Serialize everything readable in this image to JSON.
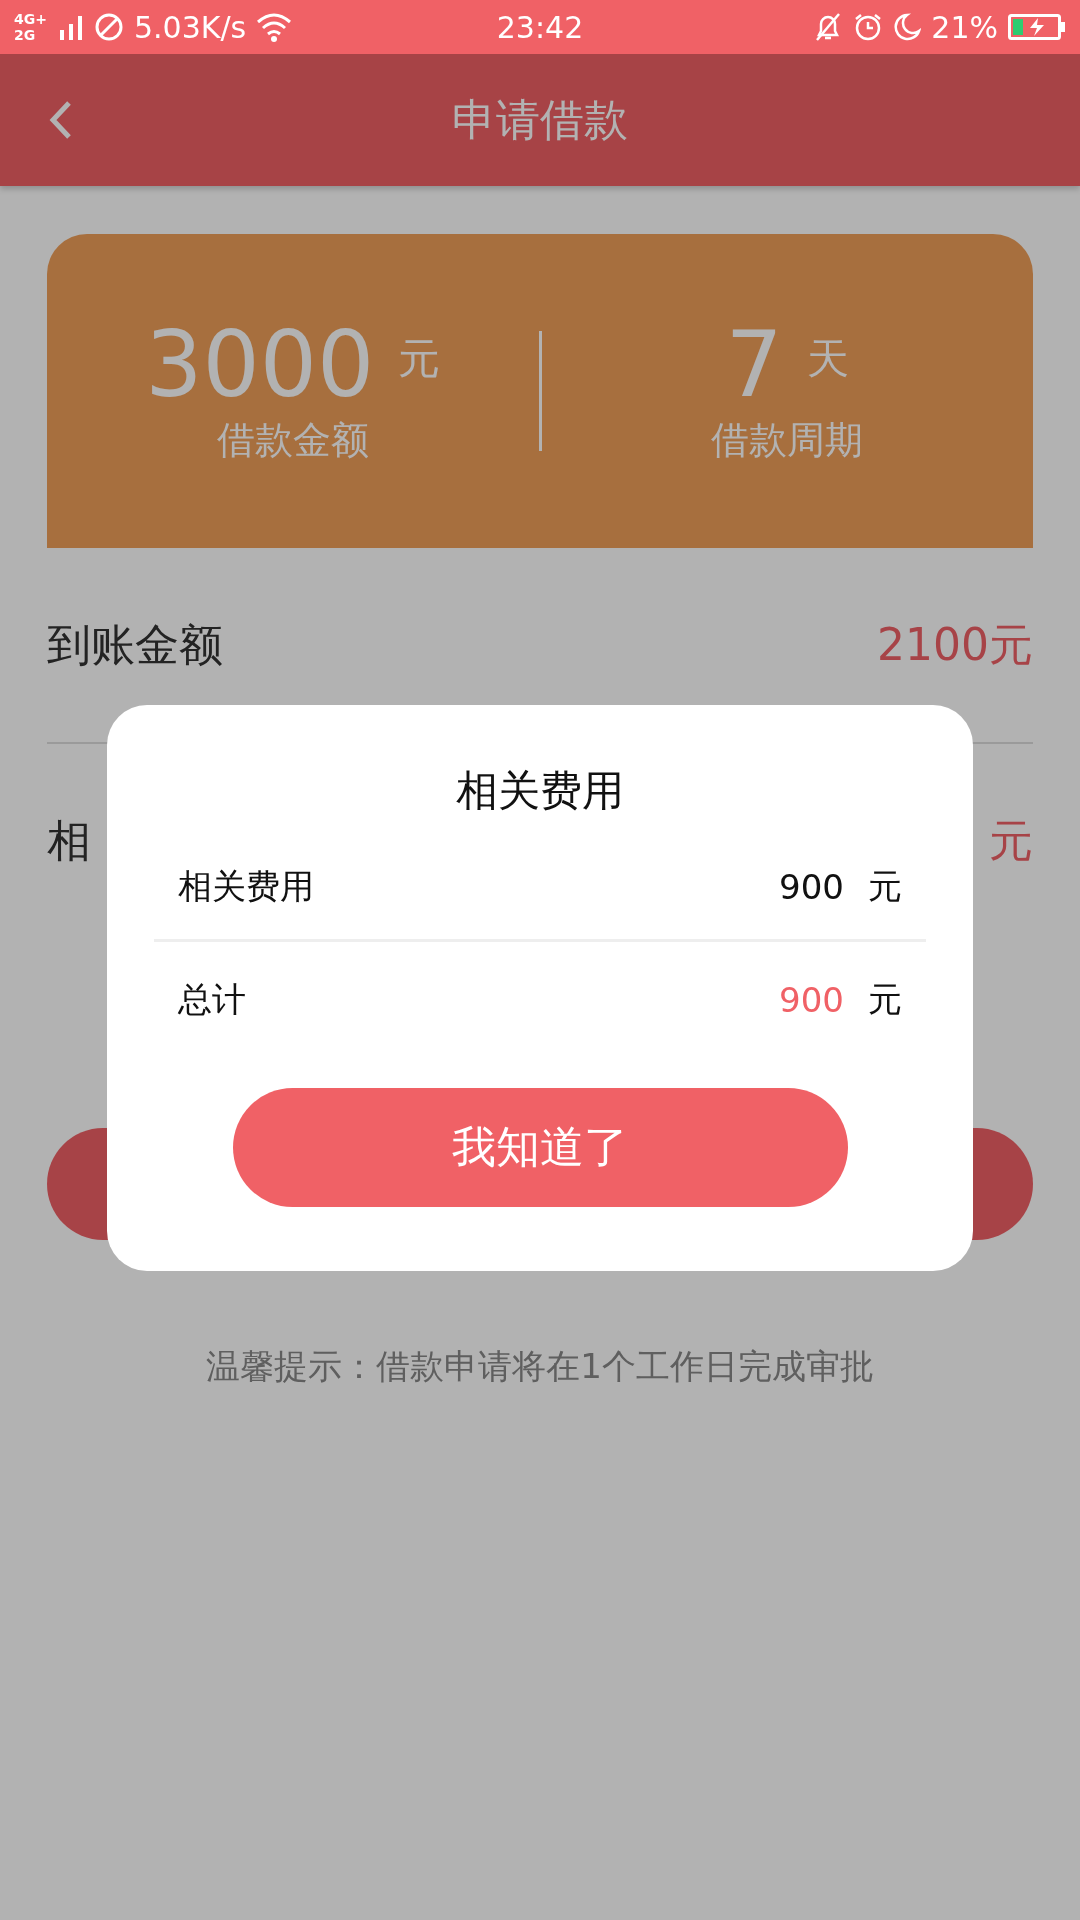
{
  "status_bar": {
    "network": "4G+ 2G",
    "speed": "5.03K/s",
    "time": "23:42",
    "battery": "21%"
  },
  "header": {
    "title": "申请借款"
  },
  "summary": {
    "amount": "3000",
    "amount_unit": "元",
    "amount_label": "借款金额",
    "period": "7",
    "period_unit": "天",
    "period_label": "借款周期"
  },
  "rows": [
    {
      "label": "到账金额",
      "value": "2100元"
    },
    {
      "label": "相",
      "value": "元"
    }
  ],
  "tip": "温馨提示：借款申请将在1个工作日完成审批",
  "dialog": {
    "title": "相关费用",
    "rows": [
      {
        "label": "相关费用",
        "amount": "900",
        "unit": "元",
        "highlight": false
      },
      {
        "label": "总计",
        "amount": "900",
        "unit": "元",
        "highlight": true
      }
    ],
    "button": "我知道了"
  }
}
